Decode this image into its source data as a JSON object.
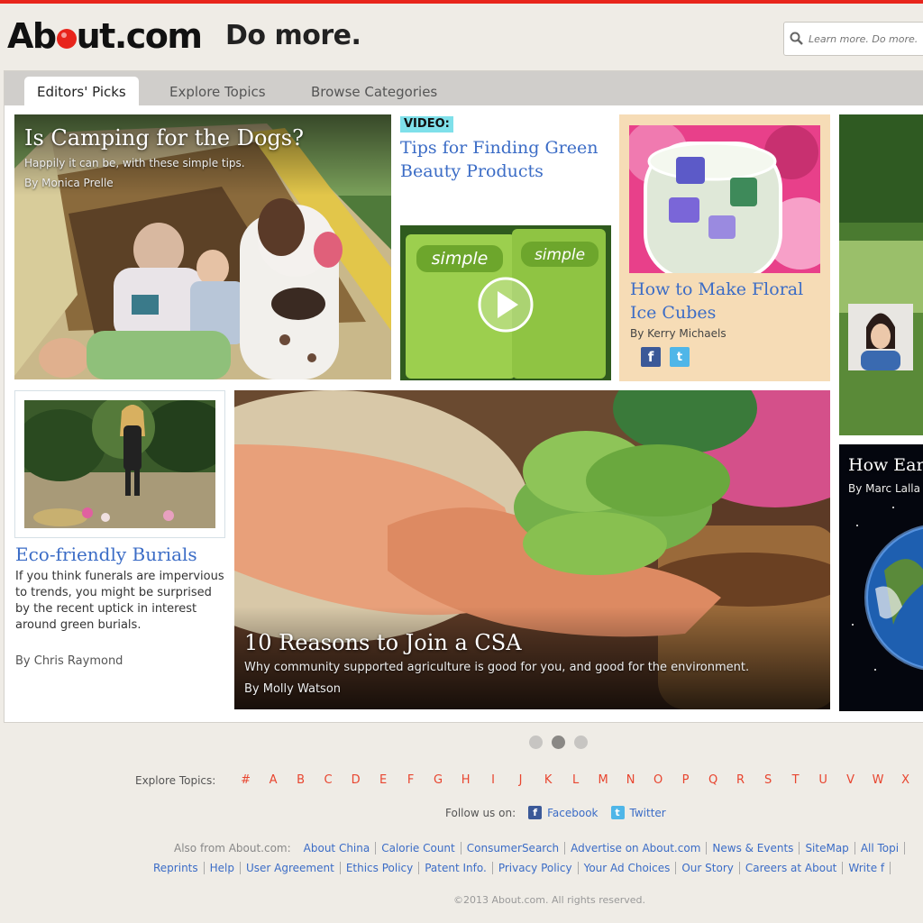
{
  "header": {
    "logo_text_a": "Ab",
    "logo_text_b": "ut.com",
    "tagline": "Do more.",
    "search_placeholder": "Learn more. Do more."
  },
  "tabs": [
    {
      "label": "Editors' Picks",
      "active": true
    },
    {
      "label": "Explore Topics",
      "active": false
    },
    {
      "label": "Browse Categories",
      "active": false
    }
  ],
  "cards": {
    "camping": {
      "title": "Is Camping for the Dogs?",
      "subtitle": "Happily it can be, with these simple tips.",
      "byline": "By Monica Prelle"
    },
    "video": {
      "badge": "VIDEO:",
      "title": "Tips for Finding Green Beauty Products"
    },
    "icecubes": {
      "title": "How to Make Floral Ice Cubes",
      "byline": "By Kerry Michaels"
    },
    "burials": {
      "title": "Eco-friendly Burials",
      "description": "If you think funerals are impervious to trends, you might be surprised by the recent uptick in interest around green burials.",
      "byline": "By Chris Raymond"
    },
    "csa": {
      "title": "10 Reasons to Join a CSA",
      "subtitle": "Why community supported agriculture is good for you, and good for the environment.",
      "byline": "By Molly Watson"
    },
    "earth": {
      "title": "How Ear",
      "byline": "By Marc Lalla"
    }
  },
  "pagination": {
    "pages": 3,
    "active": 2
  },
  "explore": {
    "label": "Explore Topics:",
    "letters": [
      "#",
      "A",
      "B",
      "C",
      "D",
      "E",
      "F",
      "G",
      "H",
      "I",
      "J",
      "K",
      "L",
      "M",
      "N",
      "O",
      "P",
      "Q",
      "R",
      "S",
      "T",
      "U",
      "V",
      "W",
      "X"
    ]
  },
  "follow": {
    "label": "Follow us on:",
    "facebook": "Facebook",
    "twitter": "Twitter"
  },
  "footer": {
    "also_from": "Also from About.com:",
    "row1": [
      "About China",
      "Calorie Count",
      "ConsumerSearch",
      "Advertise on About.com",
      "News & Events",
      "SiteMap",
      "All Topi"
    ],
    "row2": [
      "Reprints",
      "Help",
      "User Agreement",
      "Ethics Policy",
      "Patent Info.",
      "Privacy Policy",
      "Your Ad Choices",
      "Our Story",
      "Careers at About",
      "Write f"
    ],
    "copyright": "©2013 About.com. All rights reserved."
  },
  "colors": {
    "brand_red": "#e8251c",
    "link_blue": "#3b6cc6",
    "letter_orange": "#e8452f"
  }
}
